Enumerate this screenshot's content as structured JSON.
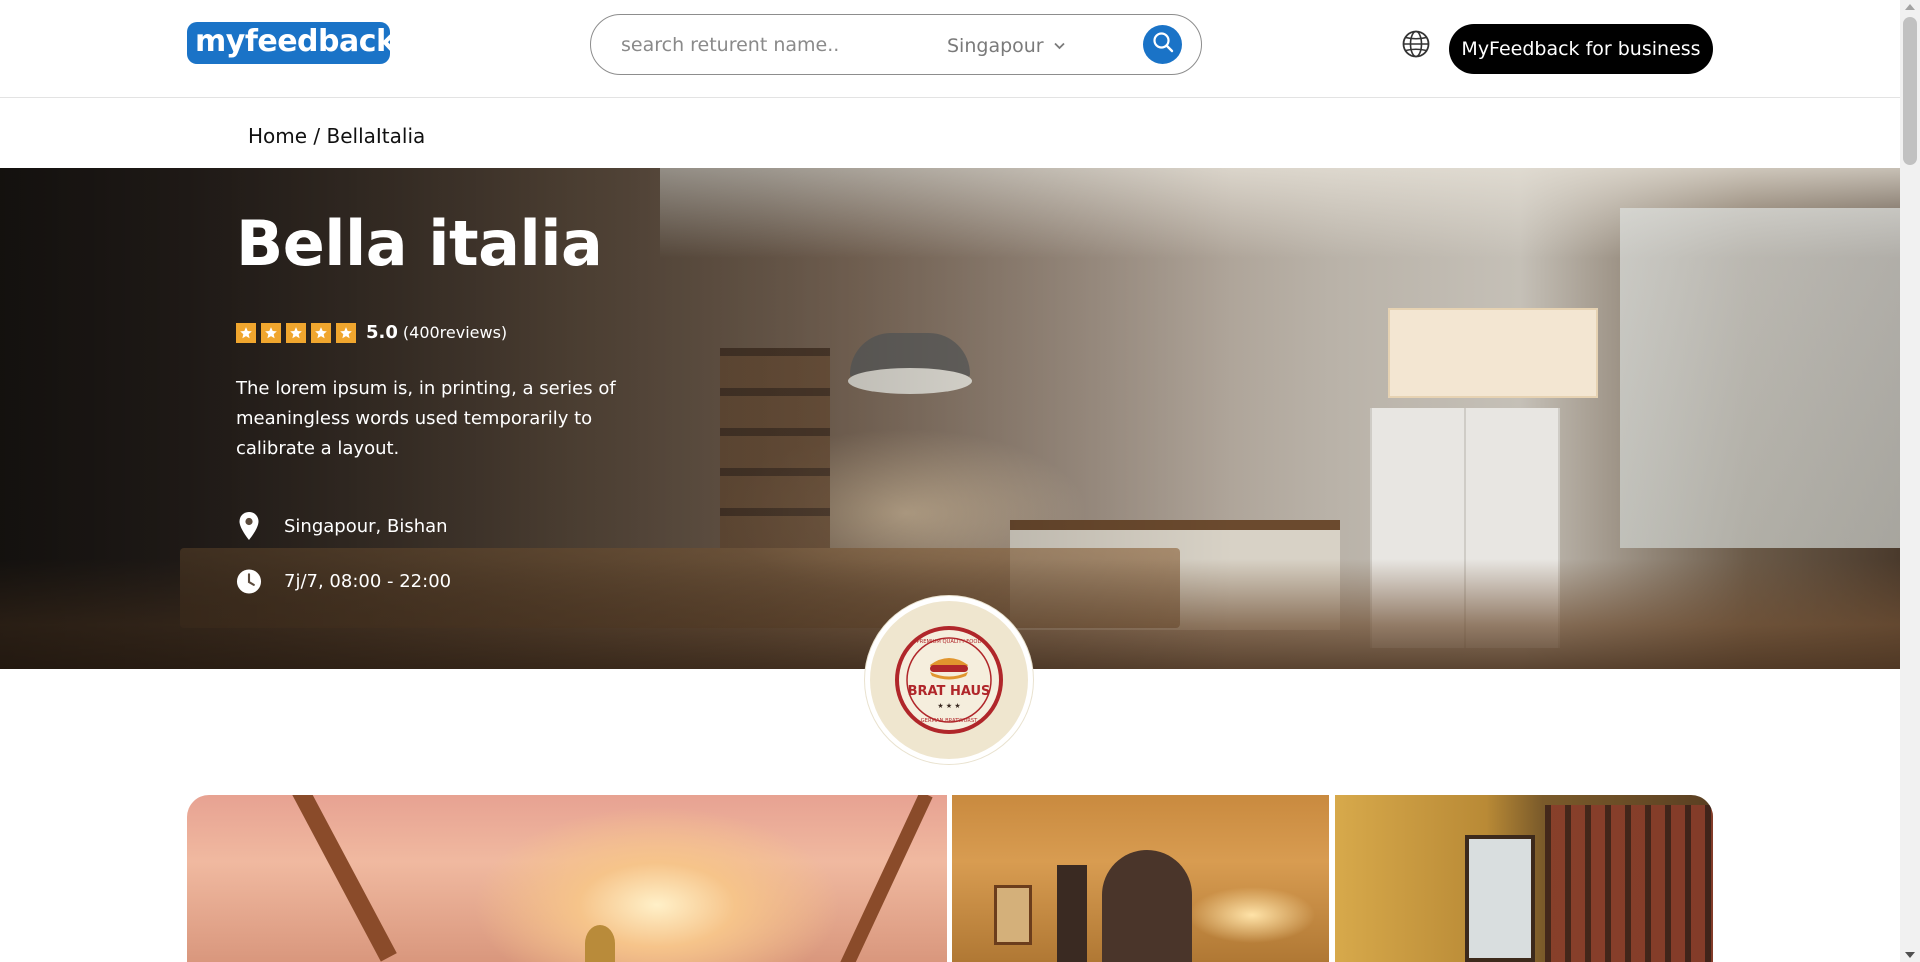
{
  "header": {
    "logo_text": "myfeedback",
    "search_placeholder": "search returent name..",
    "city": "Singapour",
    "business_button": "MyFeedback for business"
  },
  "breadcrumb": {
    "home": "Home",
    "separator": " / ",
    "current": "BellaItalia"
  },
  "restaurant": {
    "name": "Bella italia",
    "rating_stars": 5,
    "rating_score": "5.0",
    "reviews": "(400reviews)",
    "description": "The lorem ipsum is, in printing, a series of meaningless words used temporarily to calibrate a layout.",
    "location": "Singapour, Bishan",
    "hours": "7j/7, 08:00 - 22:00",
    "badge_brand": "BRAT HAUS",
    "badge_top_text": "PREMIUM QUALITY FOOD",
    "badge_bottom_text": "GERMAN BRATWURST"
  },
  "colors": {
    "brand_blue": "#1a73c7",
    "star": "#f0a62e",
    "business_button_bg": "#000000"
  },
  "icons": {
    "search": "search-icon",
    "chevron": "chevron-down-icon",
    "globe": "globe-icon",
    "location": "location-pin-icon",
    "clock": "clock-icon",
    "star": "star-icon"
  }
}
